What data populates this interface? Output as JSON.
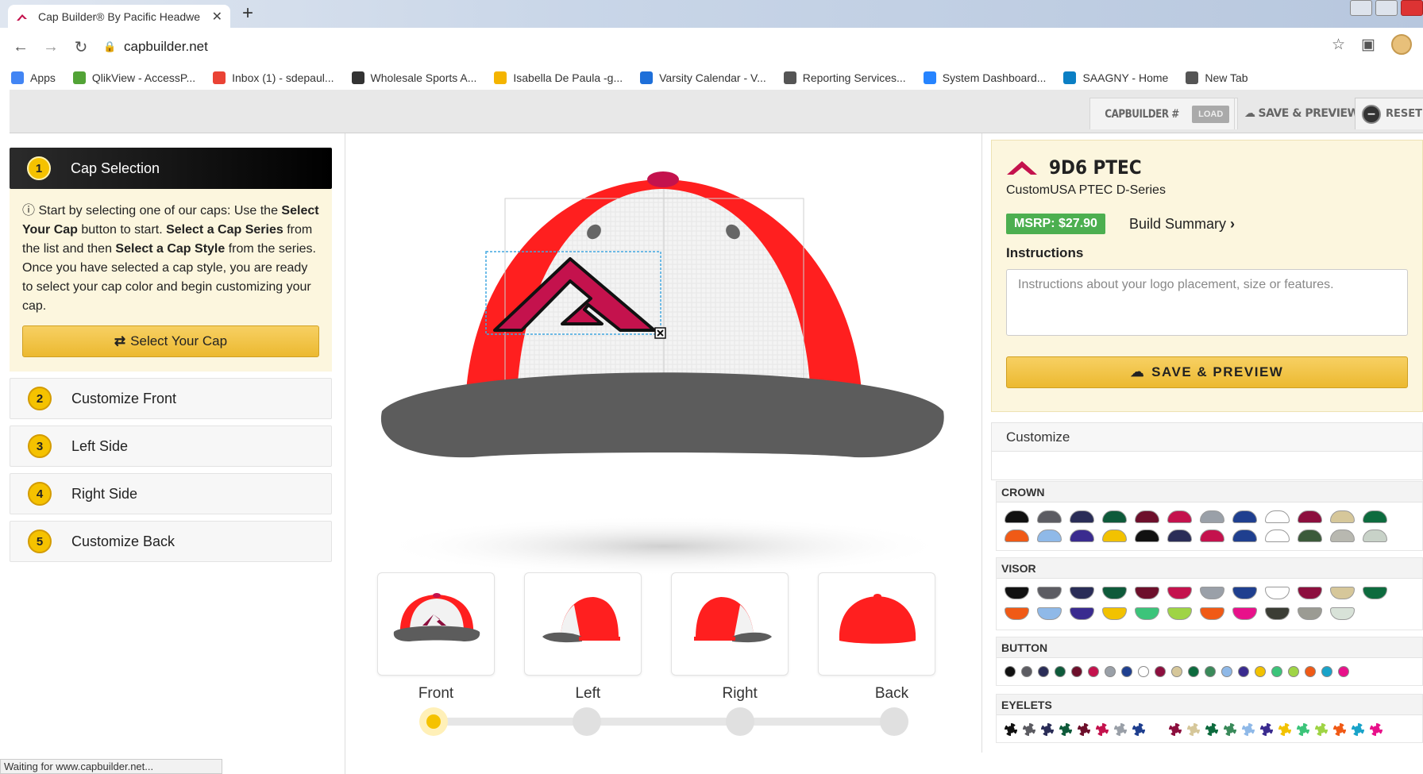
{
  "browser": {
    "tab_title": "Cap Builder® By Pacific Headwe",
    "url": "capbuilder.net",
    "bookmarks": [
      {
        "label": "Apps",
        "icon": "apps-grid-icon",
        "color": "#4285f4"
      },
      {
        "label": "QlikView - AccessP...",
        "icon": "qlik-icon",
        "color": "#52a336"
      },
      {
        "label": "Inbox (1) - sdepaul...",
        "icon": "google-icon",
        "color": "#ea4335"
      },
      {
        "label": "Wholesale Sports A...",
        "icon": "triangle-logo-icon",
        "color": "#333333"
      },
      {
        "label": "Isabella De Paula -g...",
        "icon": "slides-icon",
        "color": "#f4b400"
      },
      {
        "label": "Varsity Calendar - V...",
        "icon": "x-logo-icon",
        "color": "#1e6fd9"
      },
      {
        "label": "Reporting Services...",
        "icon": "globe-icon",
        "color": "#555555"
      },
      {
        "label": "System Dashboard...",
        "icon": "jira-icon",
        "color": "#2684ff"
      },
      {
        "label": "SAAGNY - Home",
        "icon": "sharepoint-icon",
        "color": "#0b7fc4"
      },
      {
        "label": "New Tab",
        "icon": "globe-icon",
        "color": "#555555"
      }
    ],
    "status_text": "Waiting for www.capbuilder.net..."
  },
  "toolbar": {
    "capbuilder_label": "CAPBUILDER #",
    "load_label": "LOAD",
    "save_preview_label": "SAVE & PREVIEW",
    "reset_label": "RESET"
  },
  "steps": [
    {
      "num": "1",
      "label": "Cap Selection"
    },
    {
      "num": "2",
      "label": "Customize Front"
    },
    {
      "num": "3",
      "label": "Left Side"
    },
    {
      "num": "4",
      "label": "Right Side"
    },
    {
      "num": "5",
      "label": "Customize Back"
    }
  ],
  "info": {
    "t1": "Start by selecting one of our caps: Use the ",
    "b1": "Select Your Cap",
    "t2": " button to start. ",
    "b2": "Select a Cap Series",
    "t3": " from the list and then ",
    "b3": "Select a Cap Style",
    "t4": " from the series. Once you have selected a cap style, you are ready to select your cap color and begin customizing your cap.",
    "button": "Select Your Cap"
  },
  "views": [
    "Front",
    "Left",
    "Right",
    "Back"
  ],
  "selected_view": "Front",
  "product": {
    "code": "9D6 PTEC",
    "name": "CustomUSA PTEC D-Series",
    "msrp": "MSRP: $27.90",
    "build_summary": "Build Summary",
    "instructions_label": "Instructions",
    "instructions_placeholder": "Instructions about your logo placement, size or features.",
    "save_button": "SAVE & PREVIEW"
  },
  "customize": {
    "title": "Customize",
    "crown_label": "CROWN",
    "visor_label": "VISOR",
    "button_label": "BUTTON",
    "eyelets_label": "EYELETS",
    "crown_colors_row1": [
      "#111111",
      "#5c5c62",
      "#2a2d57",
      "#0e5a3a",
      "#6d0f2b",
      "#c4124d",
      "#9aa0a8",
      "#1f3f8f",
      "#ffffff",
      "#8c0f3e",
      "#d6c79a",
      "#0d6b3e"
    ],
    "crown_colors_row2": [
      "#f05a16",
      "#8fb9e8",
      "#3a2b8f",
      "#f2c200",
      "#111111",
      "#2a2d57",
      "#c4124d",
      "#1f3f8f",
      "#ffffff",
      "#3b5a3a",
      "#b8b8b0",
      "#c8d2c8"
    ],
    "visor_colors_row1": [
      "#111111",
      "#5c5c62",
      "#2a2d57",
      "#0e5a3a",
      "#6d0f2b",
      "#c4124d",
      "#9aa0a8",
      "#1f3f8f",
      "#ffffff",
      "#8c0f3e",
      "#d6c79a",
      "#0d6b3e"
    ],
    "visor_colors_row2": [
      "#f05a16",
      "#8fb9e8",
      "#3a2b8f",
      "#f2c200",
      "#3cc47a",
      "#9fd445",
      "#f05a16",
      "#e8118a",
      "#3b3d35",
      "#9b9b93",
      "#d8e2d8"
    ],
    "button_colors": [
      "#111111",
      "#5c5c62",
      "#2a2d57",
      "#0e5a3a",
      "#6d0f2b",
      "#c4124d",
      "#9aa0a8",
      "#1f3f8f",
      "#ffffff",
      "#8c0f3e",
      "#d6c79a",
      "#0d6b3e",
      "#3a8a5a",
      "#8fb9e8",
      "#3a2b8f",
      "#f2c200",
      "#3cc47a",
      "#9fd445",
      "#f05a16",
      "#19a3c9",
      "#e8118a"
    ],
    "eyelet_colors": [
      "#111111",
      "#5c5c62",
      "#2a2d57",
      "#0e5a3a",
      "#6d0f2b",
      "#c4124d",
      "#9aa0a8",
      "#1f3f8f",
      "#ffffff",
      "#8c0f3e",
      "#d6c79a",
      "#0d6b3e",
      "#3a8a5a",
      "#8fb9e8",
      "#3a2b8f",
      "#f2c200",
      "#3cc47a",
      "#9fd445",
      "#f05a16",
      "#19a3c9",
      "#e8118a"
    ]
  },
  "cap_colors": {
    "crown_front": "#f4f4f4",
    "crown_side": "#ff1f1f",
    "visor": "#5a5a5a",
    "button": "#c4124d",
    "logo": "#c4124d"
  }
}
